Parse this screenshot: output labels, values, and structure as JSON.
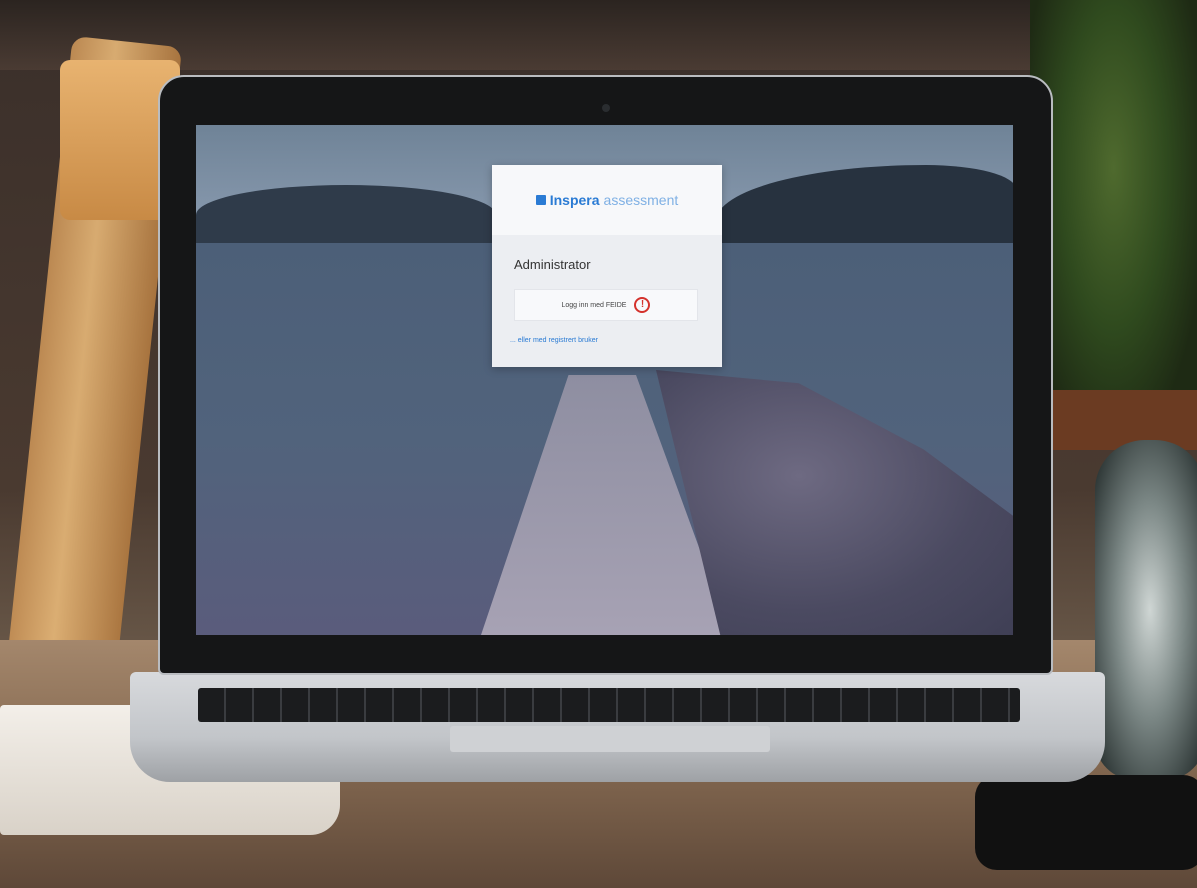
{
  "login": {
    "brand": "Inspera",
    "product": "assessment",
    "title": "Administrator",
    "feide_button_label": "Logg inn med FEIDE",
    "alt_login_link": "... eller med registrert bruker"
  },
  "colors": {
    "brand_blue": "#2a7bd4",
    "warning_red": "#d4322c"
  },
  "icons": {
    "warning": "warning-icon",
    "logo": "inspera-logo-icon"
  }
}
